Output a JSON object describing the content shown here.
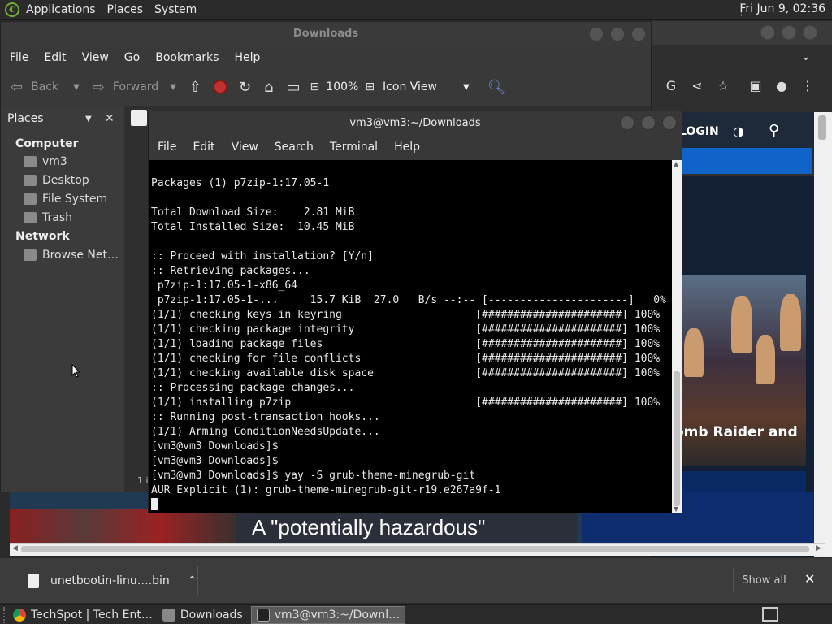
{
  "top_panel": {
    "menus": [
      "Applications",
      "Places",
      "System"
    ],
    "clock": "Fri Jun  9, 02:36"
  },
  "file_manager": {
    "title": "Downloads",
    "menus": [
      "File",
      "Edit",
      "View",
      "Go",
      "Bookmarks",
      "Help"
    ],
    "toolbar": {
      "back": "Back",
      "forward": "Forward",
      "zoom": "100%",
      "view_mode": "Icon View"
    },
    "sidebar": {
      "header": "Places",
      "sections": [
        {
          "title": "Computer",
          "items": [
            "vm3",
            "Desktop",
            "File System",
            "Trash"
          ]
        },
        {
          "title": "Network",
          "items": [
            "Browse Net…"
          ]
        }
      ]
    },
    "status": "1 i"
  },
  "terminal": {
    "title": "vm3@vm3:~/Downloads",
    "menus": [
      "File",
      "Edit",
      "View",
      "Search",
      "Terminal",
      "Help"
    ],
    "lines": [
      "Packages (1) p7zip-1:17.05-1",
      "",
      "Total Download Size:    2.81 MiB",
      "Total Installed Size:  10.45 MiB",
      "",
      ":: Proceed with installation? [Y/n]",
      ":: Retrieving packages...",
      " p7zip-1:17.05-1-x86_64",
      " p7zip-1:17.05-1-...     15.7 KiB  27.0   B/s --:-- [----------------------]   0%",
      "(1/1) checking keys in keyring                     [######################] 100%",
      "(1/1) checking package integrity                   [######################] 100%",
      "(1/1) loading package files                        [######################] 100%",
      "(1/1) checking for file conflicts                  [######################] 100%",
      "(1/1) checking available disk space                [######################] 100%",
      ":: Processing package changes...",
      "(1/1) installing p7zip                             [######################] 100%",
      ":: Running post-transaction hooks...",
      "(1/1) Arming ConditionNeedsUpdate...",
      "[vm3@vm3 Downloads]$",
      "[vm3@vm3 Downloads]$",
      "[vm3@vm3 Downloads]$ yay -S grub-theme-minegrub-git",
      "AUR Explicit (1): grub-theme-minegrub-git-r19.e267a9f-1"
    ]
  },
  "browser": {
    "login": "LOGIN",
    "hero_caption": "omb Raider and",
    "headline": "A \"potentially hazardous\"",
    "download_file": "unetbootin-linu….bin",
    "show_all": "Show all"
  },
  "taskbar": {
    "tasks": [
      {
        "label": "TechSpot | Tech Ent…",
        "active": false
      },
      {
        "label": "Downloads",
        "active": false
      },
      {
        "label": "vm3@vm3:~/Downl…",
        "active": true
      }
    ]
  },
  "colors": {
    "terminal_bg": "#000000",
    "panel_bg": "#2b2b2b",
    "site_accent": "#0f63c9",
    "stop_red": "#c0302f"
  }
}
